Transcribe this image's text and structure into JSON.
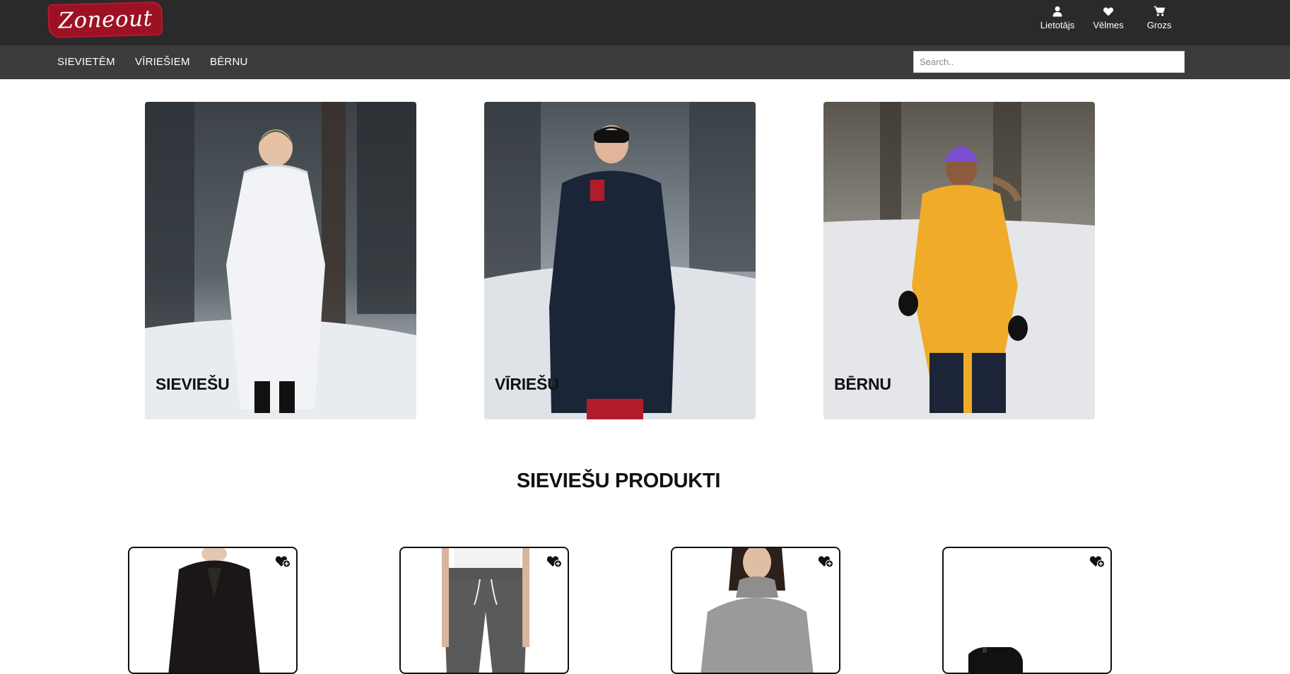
{
  "brand": {
    "logo_text": "Zoneout",
    "logo_color": "#9c1224"
  },
  "header": {
    "tools": [
      {
        "label": "Lietotājs",
        "icon": "user-icon"
      },
      {
        "label": "Vēlmes",
        "icon": "heart-icon"
      },
      {
        "label": "Grozs",
        "icon": "cart-icon"
      }
    ]
  },
  "nav": {
    "items": [
      {
        "label": "SIEVIETĒM"
      },
      {
        "label": "VĪRIEŠIEM"
      },
      {
        "label": "BĒRNU"
      }
    ]
  },
  "search": {
    "placeholder": "Search..",
    "value": ""
  },
  "categories": [
    {
      "label": "SIEVIEŠU"
    },
    {
      "label": "VĪRIEŠU"
    },
    {
      "label": "BĒRNU"
    }
  ],
  "section": {
    "title": "SIEVIEŠU PRODUKTI"
  },
  "products": [
    {
      "icon": "wishlist-add-icon"
    },
    {
      "icon": "wishlist-add-icon"
    },
    {
      "icon": "wishlist-add-icon"
    },
    {
      "icon": "wishlist-add-icon"
    }
  ],
  "colors": {
    "topbar": "#2a2a2a",
    "navbar": "#3c3c3c",
    "text": "#111111"
  }
}
